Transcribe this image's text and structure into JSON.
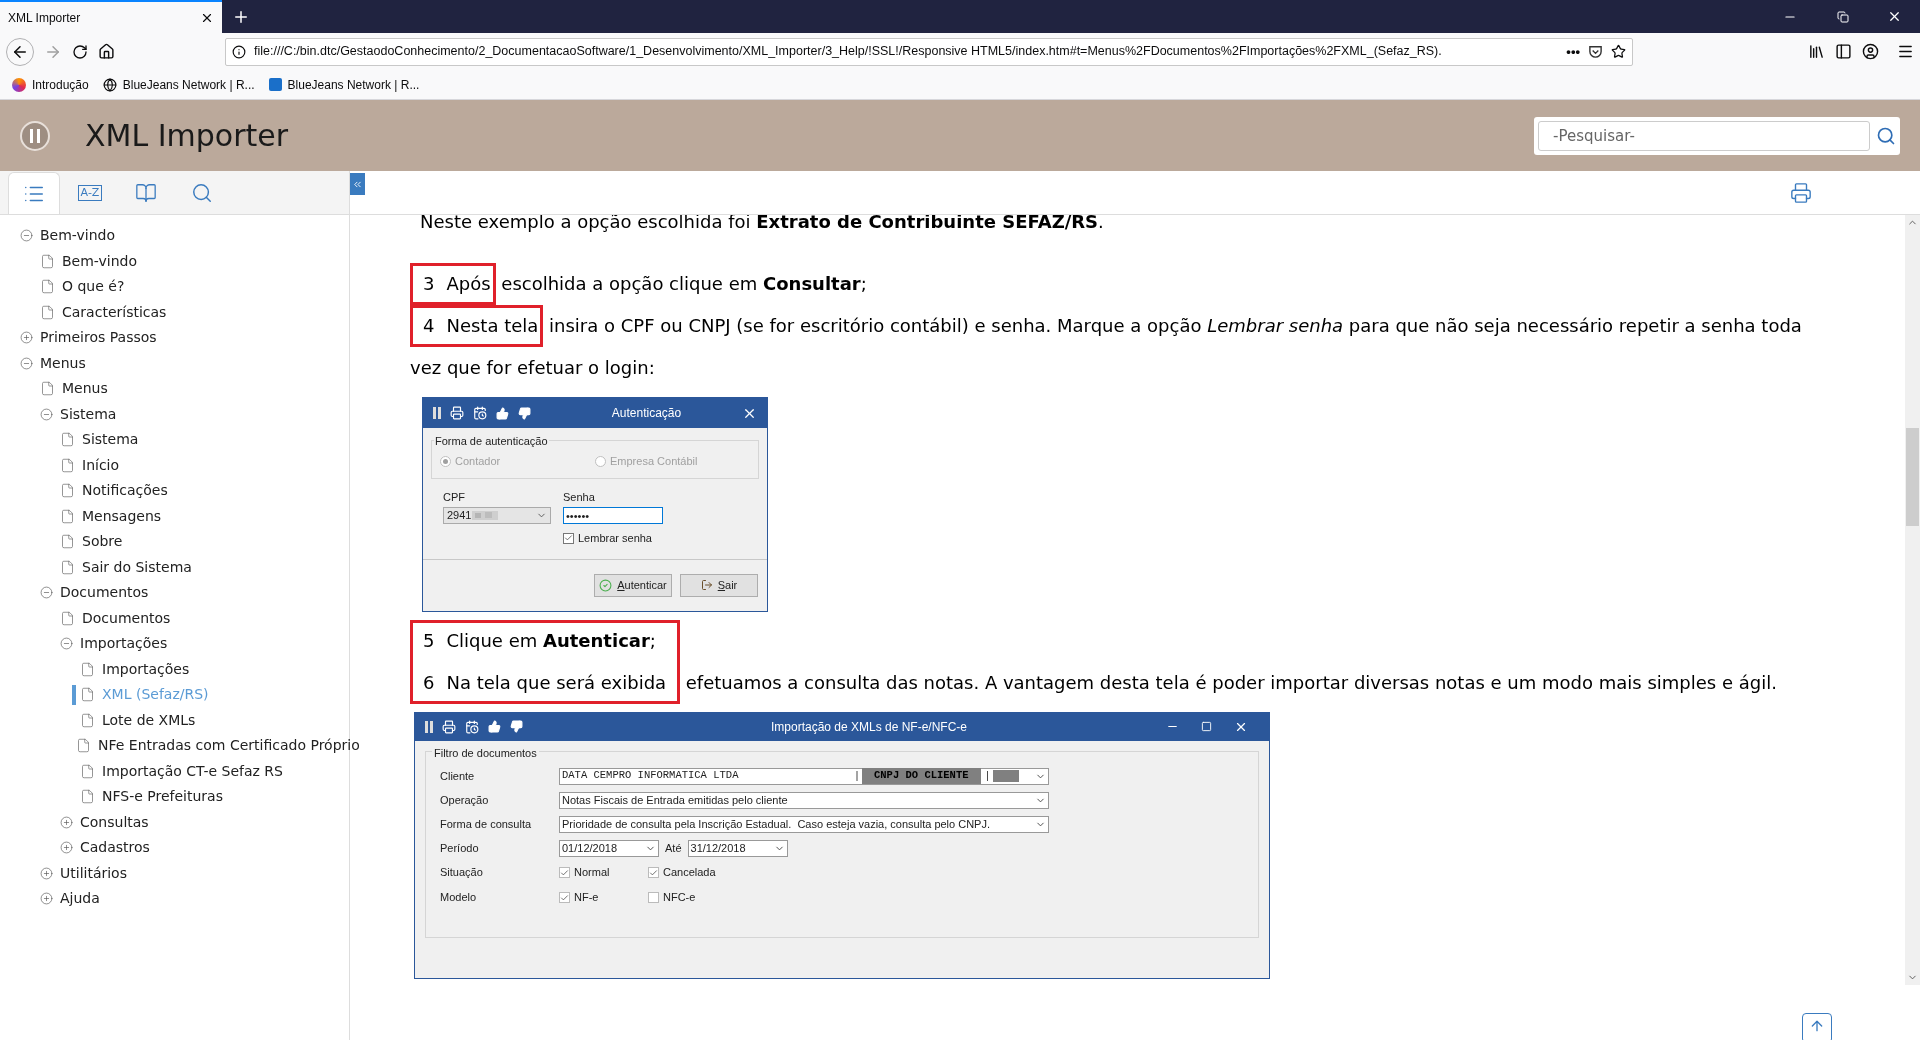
{
  "browser": {
    "tab": {
      "title": "XML Importer",
      "selected": true
    },
    "url": "file:///C:/bin.dtc/GestaodoConhecimento/2_DocumentacaoSoftware/1_Desenvolvimento/XML_Importer/3_Help/!SSL!/Responsive HTML5/index.htm#t=Menus%2FDocumentos%2FImportações%2FXML_(Sefaz_RS).",
    "page_actions": "•••",
    "bookmarks": [
      {
        "kind": "browser",
        "label": "Introdução"
      },
      {
        "kind": "globe",
        "label": "BlueJeans Network | R..."
      },
      {
        "kind": "app",
        "label": "BlueJeans Network | R..."
      }
    ]
  },
  "header": {
    "title": "XML Importer",
    "search": {
      "placeholder": "-Pesquisar-"
    }
  },
  "sidebar": {
    "tabs": [
      {
        "kind": "contents",
        "selected": true
      },
      {
        "kind": "index",
        "label": "A-Z",
        "selected": false
      },
      {
        "kind": "glossary",
        "selected": false
      },
      {
        "kind": "search",
        "selected": false
      }
    ],
    "tree": [
      {
        "label": "Bem-vindo",
        "expanded": true,
        "selected": false,
        "children": [
          {
            "label": "Bem-vindo",
            "selected": false
          },
          {
            "label": "O que é?",
            "selected": false
          },
          {
            "label": "Características",
            "selected": false
          }
        ]
      },
      {
        "label": "Primeiros Passos",
        "expanded": false,
        "selected": false
      },
      {
        "label": "Menus",
        "expanded": true,
        "selected": false,
        "children": [
          {
            "label": "Menus",
            "selected": false
          },
          {
            "label": "Sistema",
            "expanded": true,
            "selected": false,
            "children": [
              {
                "label": "Sistema",
                "selected": false
              },
              {
                "label": "Início",
                "selected": false
              },
              {
                "label": "Notificações",
                "selected": false
              },
              {
                "label": "Mensagens",
                "selected": false
              },
              {
                "label": "Sobre",
                "selected": false
              },
              {
                "label": "Sair do Sistema",
                "selected": false
              }
            ]
          },
          {
            "label": "Documentos",
            "expanded": true,
            "selected": false,
            "children": [
              {
                "label": "Documentos",
                "selected": false
              },
              {
                "label": "Importações",
                "expanded": true,
                "selected": false,
                "children": [
                  {
                    "label": "Importações",
                    "selected": false
                  },
                  {
                    "label": "XML (Sefaz/RS)",
                    "selected": true
                  },
                  {
                    "label": "Lote de XMLs",
                    "selected": false
                  },
                  {
                    "label": "NFe Entradas com Certificado Próprio",
                    "selected": false
                  },
                  {
                    "label": "Importação CT-e Sefaz RS",
                    "selected": false
                  },
                  {
                    "label": "NFS-e Prefeituras",
                    "selected": false
                  }
                ]
              },
              {
                "label": "Consultas",
                "expanded": false,
                "selected": false
              },
              {
                "label": "Cadastros",
                "expanded": false,
                "selected": false
              }
            ]
          },
          {
            "label": "Utilitários",
            "expanded": false,
            "selected": false
          },
          {
            "label": "Ajuda",
            "expanded": false,
            "selected": false
          }
        ]
      }
    ]
  },
  "content": {
    "intro": "Neste exemplo a opção escolhida foi **Extrato de Contribuinte SEFAZ/RS**.",
    "steps_before": [
      {
        "number": "3",
        "framed": "Após",
        "rest": " escolhida a opção clique em **Consultar**;",
        "kind": "boxed"
      },
      {
        "number": "4",
        "framed": "Nesta tela",
        "rest": " insira o CPF ou CNPJ (se for escritório contábil) e senha. Marque a opção *Lembrar senha* para que não seja necessário repetir a senha toda vez que for efetuar o login:",
        "kind": "boxed"
      }
    ],
    "auth_dialog": {
      "title": "Autenticação",
      "group": {
        "legend": "Forma de autenticação",
        "disabled": true,
        "options": [
          {
            "label": "Contador",
            "selected": true
          },
          {
            "label": "Empresa Contábil",
            "selected": false
          }
        ]
      },
      "cpf": {
        "label": "CPF",
        "value": "2941"
      },
      "password": {
        "label": "Senha",
        "value": "••••••"
      },
      "remember": {
        "label": "Lembrar senha",
        "checked": true
      },
      "buttons": [
        {
          "kind": "confirm",
          "label": "Autenticar"
        },
        {
          "kind": "exit",
          "label": "Sair"
        }
      ]
    },
    "steps_after": [
      {
        "number": "5",
        "framed": "Clique em **Autenticar**;",
        "kind": "boxtop"
      },
      {
        "number": "6",
        "framed": "Na tela que será exibida",
        "rest": " efetuamos a consulta das notas. A vantagem desta tela é poder importar diversas notas e um modo mais simples e ágil.",
        "kind": "boxbottom"
      }
    ],
    "import_dialog": {
      "title": "Importação de XMLs de NF-e/NFC-e",
      "legend": "Filtro de documentos",
      "rows": [
        {
          "kind": "client",
          "label": "Cliente",
          "name": "DATA CEMPRO INFORMATICA LTDA",
          "separator_1": "|",
          "tag": "CNPJ DO CLIENTE",
          "separator_2": "|"
        },
        {
          "kind": "select",
          "label": "Operação",
          "value": "Notas Fiscais de Entrada emitidas pelo cliente"
        },
        {
          "kind": "select",
          "label": "Forma de consulta",
          "value": "Prioridade de consulta pela Inscrição Estadual.  Caso esteja vazia, consulta pelo CNPJ."
        },
        {
          "kind": "period",
          "label": "Período",
          "from": "01/12/2018",
          "to_label": "Até",
          "to": "31/12/2018"
        },
        {
          "kind": "checks",
          "label": "Situação",
          "options": [
            {
              "label": "Normal",
              "checked": true
            },
            {
              "label": "Cancelada",
              "checked": true
            }
          ]
        },
        {
          "kind": "checks",
          "label": "Modelo",
          "options": [
            {
              "label": "NF-e",
              "checked": true
            },
            {
              "label": "NFC-e",
              "checked": false
            }
          ]
        }
      ]
    }
  }
}
